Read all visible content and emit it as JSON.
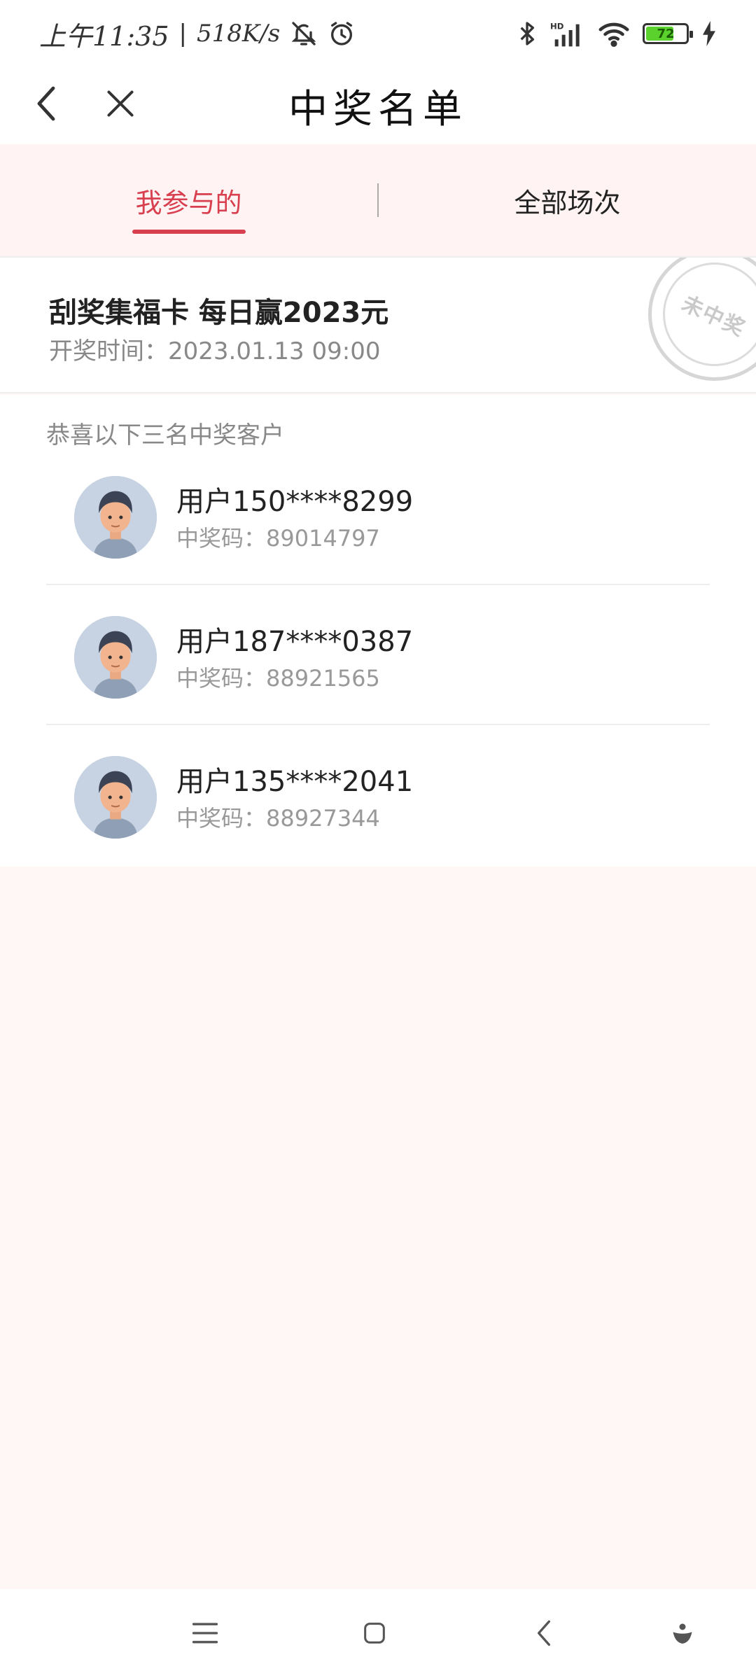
{
  "status_bar": {
    "time": "上午11:35",
    "separator": "|",
    "net_speed": "518K/s",
    "battery": "72",
    "battery_level": 0.72,
    "icons": [
      "mute-bell-icon",
      "alarm-icon",
      "bluetooth-icon",
      "hd-signal-icon",
      "wifi-icon",
      "battery-icon",
      "charging-icon"
    ]
  },
  "header": {
    "title": "中奖名单",
    "icons": [
      "back-icon",
      "close-icon"
    ]
  },
  "tabs": [
    {
      "label": "我参与的",
      "active": true
    },
    {
      "label": "全部场次",
      "active": false
    }
  ],
  "event": {
    "title": "刮奖集福卡 每日赢2023元",
    "time_label": "开奖时间：",
    "time_value": "2023.01.13 09:00",
    "stamp_text": "未中奖"
  },
  "winners": {
    "heading": "恭喜以下三名中奖客户",
    "code_label": "中奖码：",
    "list": [
      {
        "name": "用户150****8299",
        "code": "89014797"
      },
      {
        "name": "用户187****0387",
        "code": "88921565"
      },
      {
        "name": "用户135****2041",
        "code": "88927344"
      }
    ]
  },
  "colors": {
    "accent": "#d8404f",
    "tab_background": "#fff3f3",
    "page_background": "#fff6f6",
    "battery": "#5bd12e"
  },
  "bottom_nav": {
    "icons": [
      "menu-icon",
      "home-icon",
      "back-nav-icon",
      "assistant-icon"
    ]
  }
}
